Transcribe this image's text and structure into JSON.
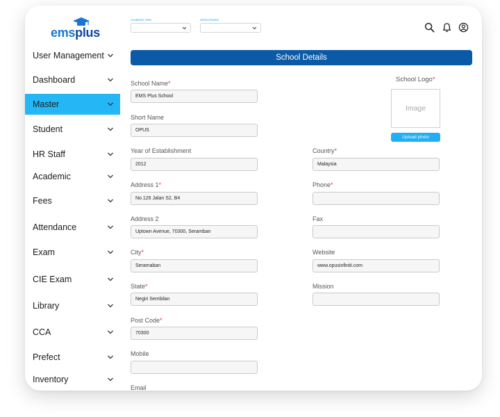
{
  "app": {
    "logo_part1": "ems",
    "logo_part2": "plus",
    "brand_color": "#1976d2",
    "accent_color": "#25b7f5",
    "banner_color": "#0b5aa8"
  },
  "sidebar": {
    "items": [
      {
        "label": "User Management"
      },
      {
        "label": "Dashboard"
      },
      {
        "label": "Master",
        "active": true
      },
      {
        "label": "Student"
      },
      {
        "label": "HR Staff"
      },
      {
        "label": "Academic"
      },
      {
        "label": "Fees"
      },
      {
        "label": "Attendance"
      },
      {
        "label": "Exam"
      },
      {
        "label": "CIE Exam"
      },
      {
        "label": "Library"
      },
      {
        "label": "CCA"
      },
      {
        "label": "Prefect"
      },
      {
        "label": "Inventory"
      }
    ]
  },
  "topbar": {
    "academic_year_label": "Academic Year",
    "academic_year_value": "",
    "school_name_label": "School Name",
    "school_name_value": "",
    "icons": [
      "search-icon",
      "bell-icon",
      "user-icon"
    ]
  },
  "page": {
    "title": "School Details"
  },
  "logo_section": {
    "label": "School Logo",
    "placeholder": "Image",
    "upload_label": "Upload photo"
  },
  "form": {
    "school_name": {
      "label": "School Name",
      "value": "EMS Plus School"
    },
    "short_name": {
      "label": "Short Name",
      "value": "OPUS"
    },
    "year": {
      "label": "Year of Establishment",
      "value": "2012"
    },
    "address1": {
      "label": "Address 1",
      "value": "No.126 Jalan S2, B4"
    },
    "address2": {
      "label": "Address 2",
      "value": "Uptown Avenue, 70300, Seramban"
    },
    "city": {
      "label": "City",
      "value": "Seramaban"
    },
    "state": {
      "label": "State",
      "value": "Negiri Sembilan"
    },
    "postcode": {
      "label": "Post Code",
      "value": "70300"
    },
    "mobile": {
      "label": "Mobile",
      "value": ""
    },
    "email": {
      "label": "Email",
      "value": ""
    },
    "country": {
      "label": "Country",
      "value": "Malaysia"
    },
    "phone": {
      "label": "Phone",
      "value": ""
    },
    "fax": {
      "label": "Fax",
      "value": ""
    },
    "website": {
      "label": "Website",
      "value": "www.opusinfiniti.com"
    },
    "mission": {
      "label": "Mission",
      "value": ""
    }
  }
}
